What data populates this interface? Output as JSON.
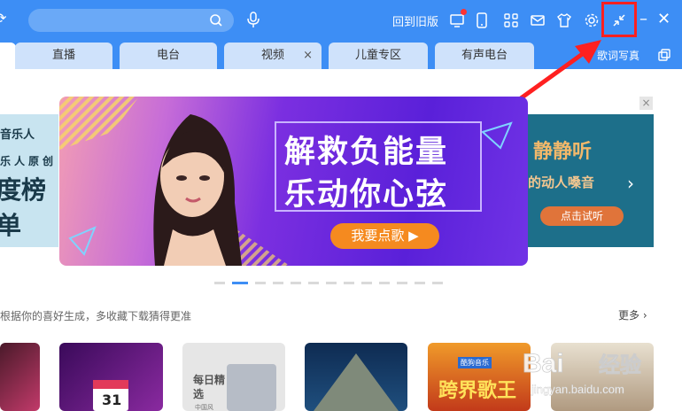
{
  "header": {
    "search_placeholder": "",
    "old_version_label": "回到旧版",
    "icons": [
      "refresh-icon",
      "search-icon",
      "voice-icon",
      "monitor-icon",
      "phone-icon",
      "apps-icon",
      "mail-icon",
      "skin-icon",
      "settings-icon",
      "mini-mode-icon",
      "minimize-icon",
      "close-icon"
    ]
  },
  "tabs": [
    {
      "label": "直播"
    },
    {
      "label": "电台"
    },
    {
      "label": "视频"
    },
    {
      "label": "儿童专区"
    },
    {
      "label": "有声电台"
    }
  ],
  "tab_close_glyph": "×",
  "lyric_label": "歌词写真",
  "carousel": {
    "left_card": {
      "line1": "音乐人",
      "line2": "乐人原创",
      "line3": "度榜单"
    },
    "main": {
      "line1": "解救负能量",
      "line2": "乐动你心弦",
      "button": "我要点歌"
    },
    "right_card": {
      "line1": "静静听",
      "line2": "的动人嗓音",
      "button": "点击试听"
    },
    "close_glyph": "×",
    "slide_count": 13,
    "active_slide": 2
  },
  "recommend": {
    "description": "根据你的喜好生成，多收藏下载猜得更准",
    "more_label": "更多 ›"
  },
  "cards": [
    {
      "text": ""
    },
    {
      "text": "31"
    },
    {
      "text": "每日精选",
      "sub": "中国风"
    },
    {
      "text": ""
    },
    {
      "text": "跨界歌王",
      "badge": "酷狗音乐"
    },
    {
      "text": ""
    }
  ],
  "watermark": {
    "brand": "Bai",
    "brand2": "经验",
    "url": "jingyan.baidu.com"
  },
  "colors": {
    "accent": "#3d8ef5",
    "highlight": "#ff2020",
    "tab_bg": "#cfe2fb"
  }
}
